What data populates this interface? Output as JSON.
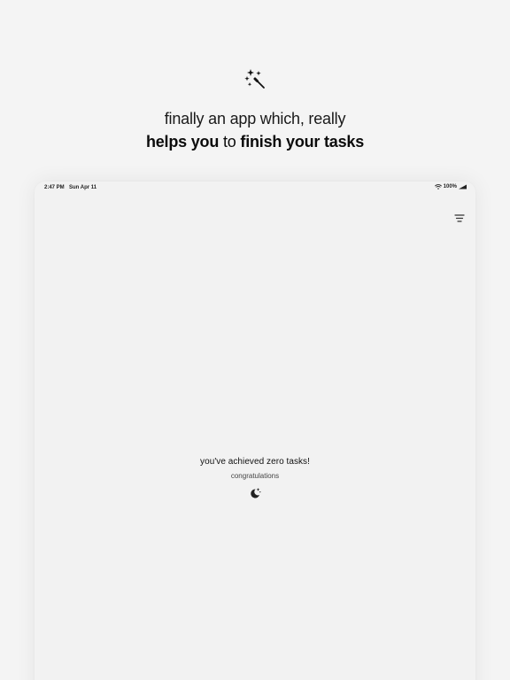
{
  "hero": {
    "icon": "magic-wand-sparkles-icon",
    "line1": "finally an app which, really",
    "line2_part1": "helps you",
    "line2_part2": "to",
    "line2_part3": "finish your tasks"
  },
  "status_bar": {
    "time": "2:47 PM",
    "date": "Sun Apr 11",
    "battery": "100%",
    "icons": [
      "wifi-icon",
      "battery-icon"
    ]
  },
  "toolbar": {
    "filter_icon": "filter-lines-icon"
  },
  "empty_state": {
    "title": "you've achieved zero tasks!",
    "subtitle": "congratulations",
    "icon": "moon-sparkle-icon"
  },
  "colors": {
    "background": "#f4f4f4",
    "device": "#f2f2f2",
    "text": "#111111"
  }
}
